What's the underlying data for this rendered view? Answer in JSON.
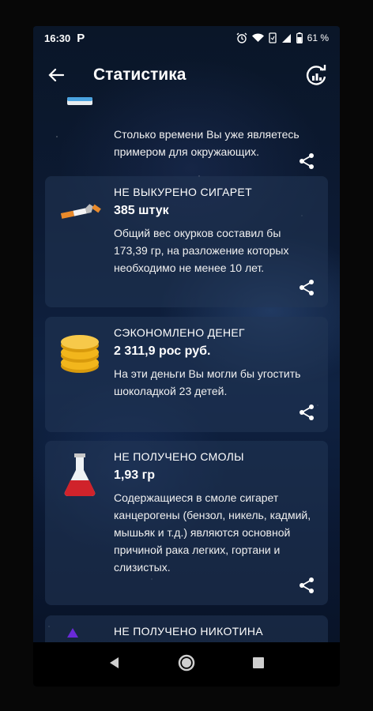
{
  "status_bar": {
    "time": "16:30",
    "app_icon": "P",
    "icons": [
      "alarm-icon",
      "wifi-icon",
      "screen-icon",
      "signal-icon",
      "battery-icon"
    ],
    "battery": "61 %"
  },
  "appbar": {
    "title": "Статистика"
  },
  "cards": [
    {
      "icon": "badge-icon",
      "desc": "Столько времени Вы уже являетесь примером для окружающих."
    },
    {
      "icon": "cigarette-icon",
      "heading": "НЕ ВЫКУРЕНО СИГАРЕТ",
      "value": "385 штук",
      "desc": "Общий вес окурков составил бы 173,39 гр, на разложение которых необходимо не менее 10 лет."
    },
    {
      "icon": "coins-icon",
      "heading": "СЭКОНОМЛЕНО ДЕНЕГ",
      "value": "2 311,9 рос руб.",
      "desc": "На эти деньги Вы могли бы угостить шоколадкой 23 детей."
    },
    {
      "icon": "flask-icon",
      "heading": "НЕ ПОЛУЧЕНО СМОЛЫ",
      "value": "1,93 гр",
      "desc": "Содержащиеся в смоле сигарет канцерогены (бензол, никель, кадмий, мышьяк и т.д.) являются основной причиной рака легких, гортани и слизистых."
    },
    {
      "icon": "nicotine-icon",
      "heading": "НЕ ПОЛУЧЕНО НИКОТИНА"
    }
  ],
  "colors": {
    "card_bg": "#23375a",
    "flask_liquid": "#d0232b",
    "coin_gold": "#f2b61c",
    "nicotine_purple": "#6a2ad8"
  }
}
